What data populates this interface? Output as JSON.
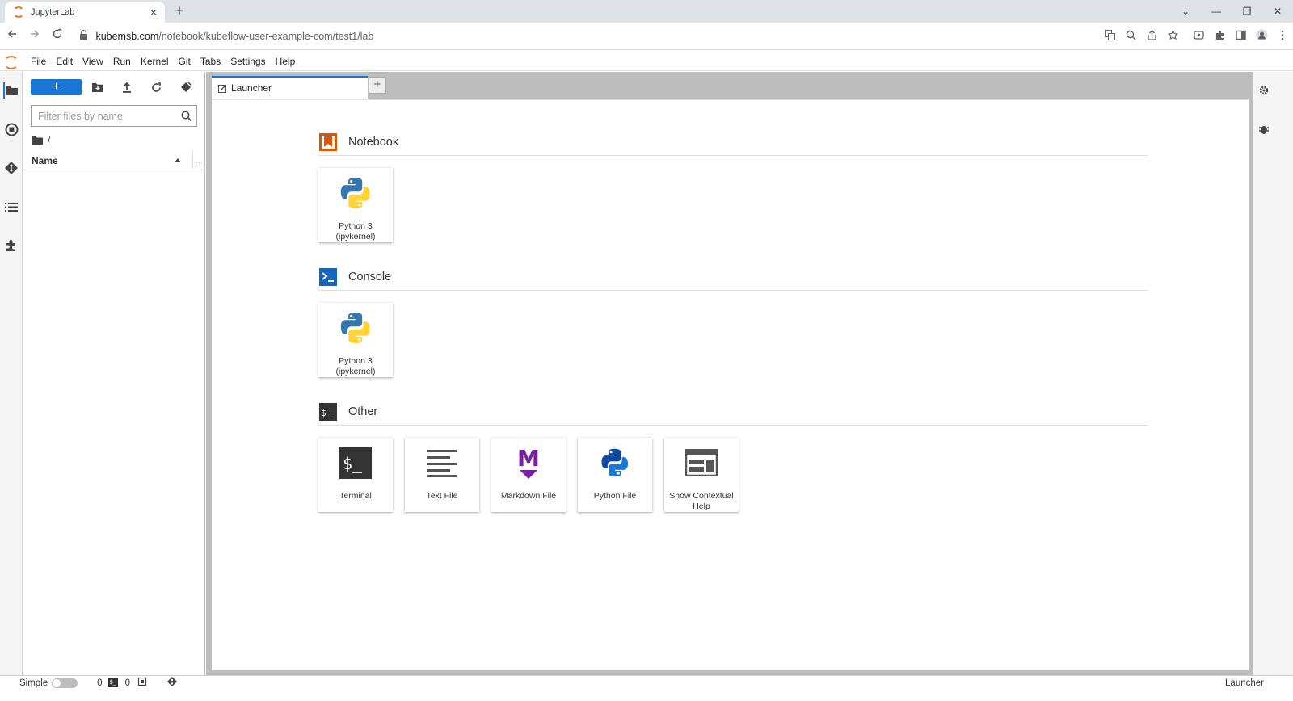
{
  "browser": {
    "tab_title": "JupyterLab",
    "tab_close": "×",
    "new_tab": "+",
    "url_host": "kubemsb.com",
    "url_path": "/notebook/kubeflow-user-example-com/test1/lab",
    "window_controls": [
      "⌄",
      "—",
      "❐",
      "✕"
    ]
  },
  "menu": {
    "items": [
      "File",
      "Edit",
      "View",
      "Run",
      "Kernel",
      "Git",
      "Tabs",
      "Settings",
      "Help"
    ]
  },
  "filebrowser": {
    "new_button_label": "+",
    "filter_placeholder": "Filter files by name",
    "breadcrumb": "/",
    "column_name": "Name"
  },
  "dock": {
    "tab_label": "Launcher",
    "add_tab_label": "+"
  },
  "launcher": {
    "sections": [
      {
        "title": "Notebook",
        "cards": [
          {
            "label": "Python 3 (ipykernel)",
            "icon": "python-logo-icon"
          }
        ]
      },
      {
        "title": "Console",
        "cards": [
          {
            "label": "Python 3 (ipykernel)",
            "icon": "python-logo-icon"
          }
        ]
      },
      {
        "title": "Other",
        "cards": [
          {
            "label": "Terminal",
            "icon": "terminal-icon"
          },
          {
            "label": "Text File",
            "icon": "text-file-icon"
          },
          {
            "label": "Markdown File",
            "icon": "markdown-icon"
          },
          {
            "label": "Python File",
            "icon": "python-file-icon"
          },
          {
            "label": "Show Contextual Help",
            "icon": "contextual-help-icon"
          }
        ]
      }
    ]
  },
  "statusbar": {
    "simple_label": "Simple",
    "terminals_count": "0",
    "terminal_glyph": "$_",
    "kernels_count": "0",
    "right_label": "Launcher"
  },
  "colors": {
    "accent": "#1976d2",
    "notebook_icon": "#e65100",
    "console_icon": "#0d47a1",
    "markdown_icon": "#7b1fa2",
    "jupyter_orange": "#f37626"
  }
}
